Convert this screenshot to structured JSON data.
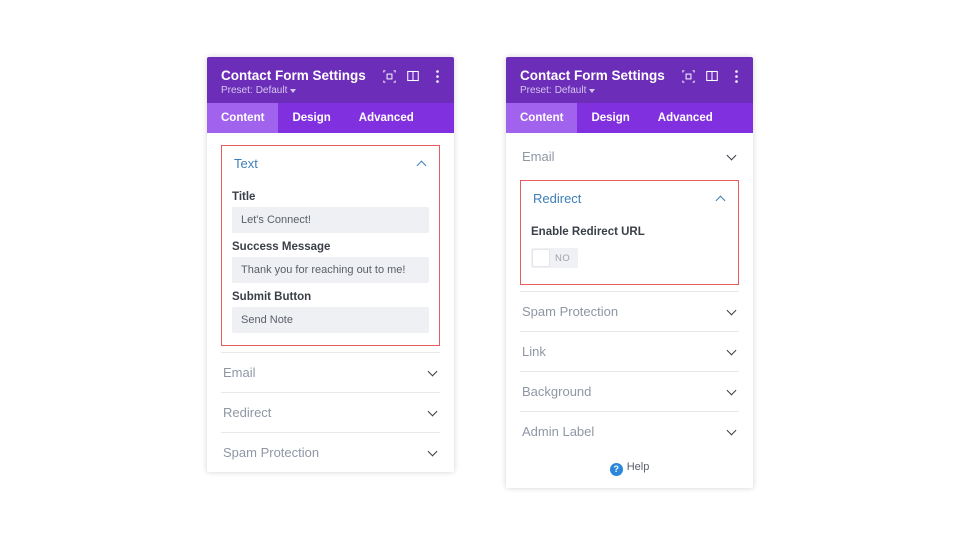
{
  "header": {
    "title": "Contact Form Settings",
    "preset_label": "Preset:",
    "preset_value": "Default"
  },
  "tabs": {
    "content": "Content",
    "design": "Design",
    "advanced": "Advanced"
  },
  "left": {
    "text_section": {
      "title": "Text",
      "fields": {
        "title_label": "Title",
        "title_value": "Let's Connect!",
        "success_label": "Success Message",
        "success_value": "Thank you for reaching out to me!",
        "submit_label": "Submit Button",
        "submit_value": "Send Note"
      }
    },
    "sections": {
      "email": "Email",
      "redirect": "Redirect",
      "spam": "Spam Protection"
    }
  },
  "right": {
    "email_title": "Email",
    "redirect": {
      "title": "Redirect",
      "enable_label": "Enable Redirect URL",
      "toggle_value": "NO"
    },
    "sections": {
      "spam": "Spam Protection",
      "link": "Link",
      "background": "Background",
      "admin": "Admin Label"
    },
    "help": "Help"
  }
}
